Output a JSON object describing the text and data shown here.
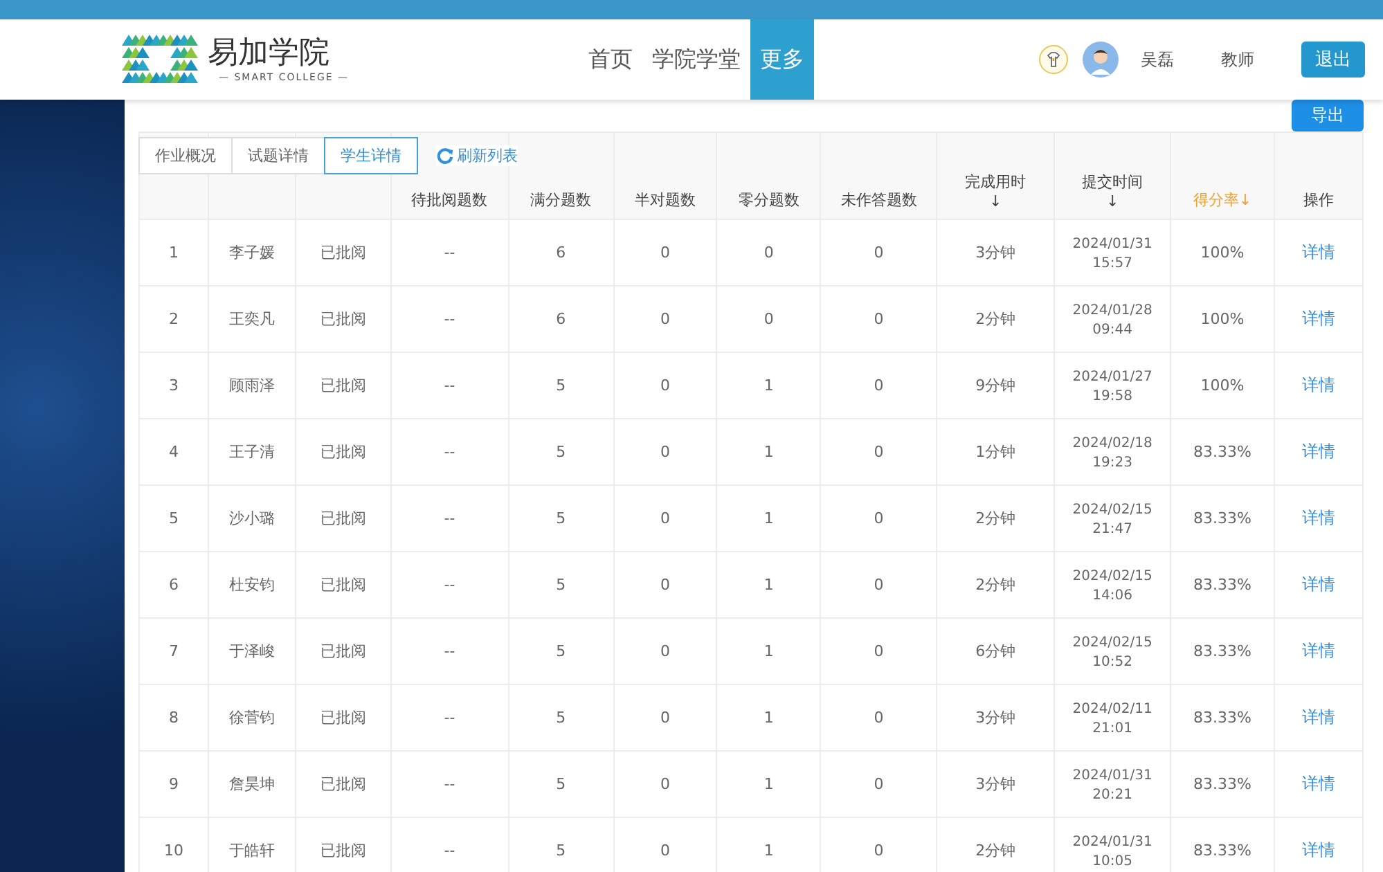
{
  "header": {
    "logo": {
      "title": "易加学院",
      "subtitle": "— SMART COLLEGE —"
    },
    "nav": [
      {
        "label": "首页",
        "selected": false
      },
      {
        "label": "学院学堂",
        "selected": false
      },
      {
        "label": "更多",
        "selected": true
      }
    ],
    "user": {
      "name": "吴磊",
      "role": "教师"
    },
    "logout": "退出"
  },
  "export_button": "导出",
  "tabs": [
    {
      "label": "作业概况",
      "selected": false
    },
    {
      "label": "试题详情",
      "selected": false
    },
    {
      "label": "学生详情",
      "selected": true
    }
  ],
  "refresh_link": "刷新列表",
  "table": {
    "columns": [
      null,
      null,
      null,
      {
        "label": "待批阅题数",
        "active": false
      },
      {
        "label": "满分题数",
        "active": false
      },
      {
        "label": "半对题数",
        "active": false
      },
      {
        "label": "零分题数",
        "active": false
      },
      {
        "label": "未作答题数",
        "active": false
      },
      {
        "label": "完成用时",
        "sort_arrow": "↓",
        "active": false
      },
      {
        "label": "提交时间",
        "sort_arrow": "↓",
        "active": false
      },
      {
        "label": "得分率↓",
        "active": true
      },
      {
        "label": "操作",
        "active": false
      }
    ],
    "rows": [
      [
        "1",
        "李子媛",
        "已批阅",
        "--",
        "6",
        "0",
        "0",
        "0",
        "3分钟",
        "2024/01/31 15:57",
        "100%",
        "详情"
      ],
      [
        "2",
        "王奕凡",
        "已批阅",
        "--",
        "6",
        "0",
        "0",
        "0",
        "2分钟",
        "2024/01/28 09:44",
        "100%",
        "详情"
      ],
      [
        "3",
        "顾雨泽",
        "已批阅",
        "--",
        "5",
        "0",
        "1",
        "0",
        "9分钟",
        "2024/01/27 19:58",
        "100%",
        "详情"
      ],
      [
        "4",
        "王子清",
        "已批阅",
        "--",
        "5",
        "0",
        "1",
        "0",
        "1分钟",
        "2024/02/18 19:23",
        "83.33%",
        "详情"
      ],
      [
        "5",
        "沙小璐",
        "已批阅",
        "--",
        "5",
        "0",
        "1",
        "0",
        "2分钟",
        "2024/02/15 21:47",
        "83.33%",
        "详情"
      ],
      [
        "6",
        "杜安钧",
        "已批阅",
        "--",
        "5",
        "0",
        "1",
        "0",
        "2分钟",
        "2024/02/15 14:06",
        "83.33%",
        "详情"
      ],
      [
        "7",
        "于泽峻",
        "已批阅",
        "--",
        "5",
        "0",
        "1",
        "0",
        "6分钟",
        "2024/02/15 10:52",
        "83.33%",
        "详情"
      ],
      [
        "8",
        "徐菅钧",
        "已批阅",
        "--",
        "5",
        "0",
        "1",
        "0",
        "3分钟",
        "2024/02/11 21:01",
        "83.33%",
        "详情"
      ],
      [
        "9",
        "詹昊坤",
        "已批阅",
        "--",
        "5",
        "0",
        "1",
        "0",
        "3分钟",
        "2024/01/31 20:21",
        "83.33%",
        "详情"
      ],
      [
        "10",
        "于皓轩",
        "已批阅",
        "--",
        "5",
        "0",
        "1",
        "0",
        "2分钟",
        "2024/01/31 10:05",
        "83.33%",
        "详情"
      ]
    ]
  }
}
